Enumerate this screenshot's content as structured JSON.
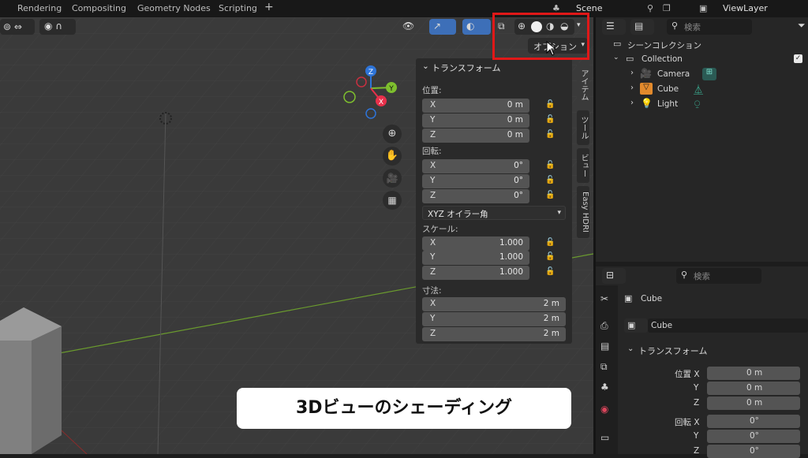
{
  "topbar": {
    "tabs": [
      "Rendering",
      "Compositing",
      "Geometry Nodes",
      "Scripting"
    ],
    "add_label": "+",
    "scene_label": "Scene",
    "viewlayer_label": "ViewLayer"
  },
  "viewport_header": {
    "options_label": "オプション"
  },
  "npanel": {
    "title": "トランスフォーム",
    "location_label": "位置:",
    "location": [
      {
        "axis": "X",
        "value": "0 m"
      },
      {
        "axis": "Y",
        "value": "0 m"
      },
      {
        "axis": "Z",
        "value": "0 m"
      }
    ],
    "rotation_label": "回転:",
    "rotation": [
      {
        "axis": "X",
        "value": "0°"
      },
      {
        "axis": "Y",
        "value": "0°"
      },
      {
        "axis": "Z",
        "value": "0°"
      }
    ],
    "rotation_mode": "XYZ オイラー角",
    "scale_label": "スケール:",
    "scale": [
      {
        "axis": "X",
        "value": "1.000"
      },
      {
        "axis": "Y",
        "value": "1.000"
      },
      {
        "axis": "Z",
        "value": "1.000"
      }
    ],
    "dimensions_label": "寸法:",
    "dimensions": [
      {
        "axis": "X",
        "value": "2 m"
      },
      {
        "axis": "Y",
        "value": "2 m"
      },
      {
        "axis": "Z",
        "value": "2 m"
      }
    ]
  },
  "side_tabs": [
    "アイテム",
    "ツール",
    "ビュー",
    "Easy HDRI"
  ],
  "gizmo": {
    "x": "X",
    "y": "Y",
    "z": "Z"
  },
  "outliner": {
    "search_placeholder": "検索",
    "scene_collection": "シーンコレクション",
    "collection": "Collection",
    "objects": [
      "Camera",
      "Cube",
      "Light"
    ]
  },
  "properties": {
    "search_placeholder": "検索",
    "object_name": "Cube",
    "object_field": "Cube",
    "section_title": "トランスフォーム",
    "location_label": "位置 X",
    "location": [
      {
        "axis": "位置 X",
        "value": "0 m"
      },
      {
        "axis": "Y",
        "value": "0 m"
      },
      {
        "axis": "Z",
        "value": "0 m"
      }
    ],
    "rotation": [
      {
        "axis": "回転 X",
        "value": "0°"
      },
      {
        "axis": "Y",
        "value": "0°"
      },
      {
        "axis": "Z",
        "value": "0°"
      }
    ]
  },
  "caption": "3Dビューのシェーディング",
  "colors": {
    "highlight": "#e01818",
    "x_axis": "#e8304a",
    "y_axis": "#7ebf2e",
    "z_axis": "#2e74d8"
  }
}
